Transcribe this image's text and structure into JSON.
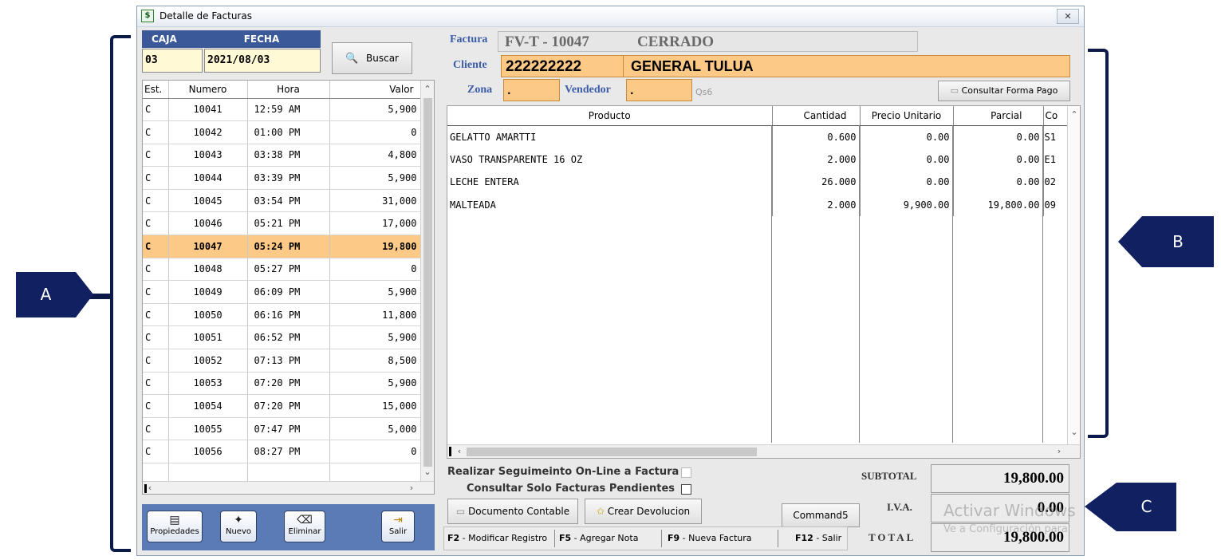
{
  "window": {
    "title": "Detalle de Facturas",
    "title_icon_glyph": "$",
    "close_glyph": "✕"
  },
  "filters": {
    "caja_label": "CAJA",
    "fecha_label": "FECHA",
    "caja_value": "03",
    "fecha_value": "2021/08/03",
    "search_button": "Buscar"
  },
  "invoice_list": {
    "columns": [
      "Est.",
      "Numero",
      "Hora",
      "Valor"
    ],
    "rows": [
      [
        "C",
        "10041",
        "12:59 AM",
        "5,900"
      ],
      [
        "C",
        "10042",
        "01:00 PM",
        "0"
      ],
      [
        "C",
        "10043",
        "03:38 PM",
        "4,800"
      ],
      [
        "C",
        "10044",
        "03:39 PM",
        "5,900"
      ],
      [
        "C",
        "10045",
        "03:54 PM",
        "31,000"
      ],
      [
        "C",
        "10046",
        "05:21 PM",
        "17,000"
      ],
      [
        "C",
        "10047",
        "05:24 PM",
        "19,800"
      ],
      [
        "C",
        "10048",
        "05:27 PM",
        "0"
      ],
      [
        "C",
        "10049",
        "06:09 PM",
        "5,900"
      ],
      [
        "C",
        "10050",
        "06:16 PM",
        "11,800"
      ],
      [
        "C",
        "10051",
        "06:52 PM",
        "5,900"
      ],
      [
        "C",
        "10052",
        "07:13 PM",
        "8,500"
      ],
      [
        "C",
        "10053",
        "07:20 PM",
        "5,900"
      ],
      [
        "C",
        "10054",
        "07:20 PM",
        "15,000"
      ],
      [
        "C",
        "10055",
        "07:47 PM",
        "5,000"
      ],
      [
        "C",
        "10056",
        "08:27 PM",
        "0"
      ]
    ],
    "selected_index": 6
  },
  "toolbar": {
    "propiedades": "Propiedades",
    "nuevo": "Nuevo",
    "eliminar": "Eliminar",
    "salir": "Salir"
  },
  "invoice": {
    "factura_label": "Factura",
    "factura_value": "FV-T - 10047",
    "status": "CERRADO",
    "cliente_label": "Cliente",
    "cliente_id": "222222222",
    "cliente_name": "GENERAL TULUA",
    "zona_label": "Zona",
    "zona_value": ".",
    "vendedor_label": "Vendedor",
    "vendedor_value": ".",
    "small_code": "Qs6",
    "consult_payment_button": "Consultar Forma Pago"
  },
  "products": {
    "columns": [
      "Producto",
      "Cantidad",
      "Precio Unitario",
      "Parcial",
      "Co"
    ],
    "rows": [
      [
        "GELATTO AMARTTI",
        "0.600",
        "0.00",
        "0.00",
        "S1"
      ],
      [
        "VASO  TRANSPARENTE 16 OZ",
        "2.000",
        "0.00",
        "0.00",
        "E1"
      ],
      [
        "LECHE ENTERA",
        "26.000",
        "0.00",
        "0.00",
        "02"
      ],
      [
        "MALTEADA",
        "2.000",
        "9,900.00",
        "19,800.00",
        "09"
      ]
    ]
  },
  "options": {
    "seguimiento_label": "Realizar Seguimeinto On-Line a Factura",
    "pendientes_label": "Consultar Solo Facturas Pendientes"
  },
  "actions": {
    "documento_contable": "Documento Contable",
    "crear_devolucion": "Crear Devolucion",
    "command5": "Command5"
  },
  "fkeys": [
    {
      "key": "F2",
      "text": " - Modificar Registro"
    },
    {
      "key": "F5",
      "text": " - Agregar  Nota"
    },
    {
      "key": "F9",
      "text": " - Nueva Factura"
    },
    {
      "key": "F12",
      "text": " - Salir"
    }
  ],
  "totals": {
    "subtotal_label": "SUBTOTAL",
    "subtotal_value": "19,800.00",
    "iva_label": "I.V.A.",
    "iva_value": "0.00",
    "total_label": "TOTAL",
    "total_value": "19,800.00"
  },
  "watermark": {
    "line1": "Activar Windows",
    "line2": "Ve a Configuración para"
  },
  "annotations": {
    "a": "A",
    "b": "B",
    "c": "C",
    "color": "#102060"
  }
}
